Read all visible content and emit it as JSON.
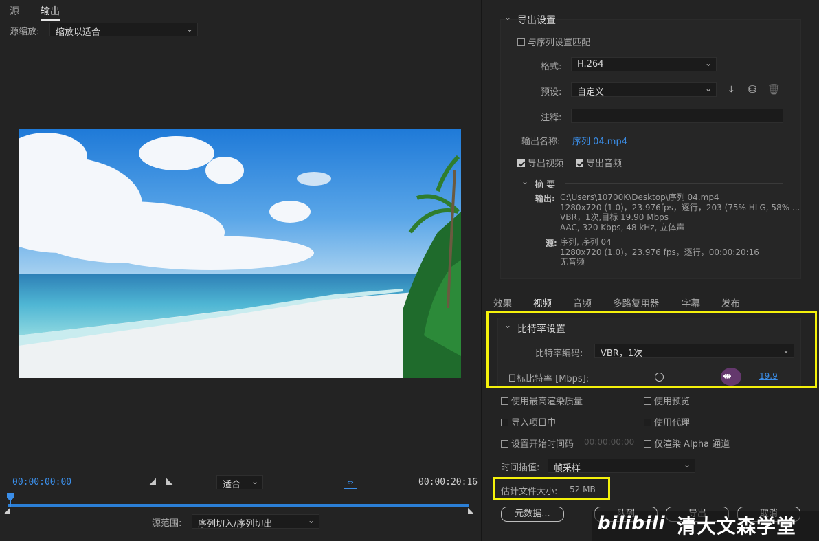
{
  "left": {
    "tabs": [
      "源",
      "输出"
    ],
    "source_zoom_label": "源缩放:",
    "source_zoom_value": "缩放以适合",
    "time_start": "00:00:00:00",
    "time_end": "00:00:20:16",
    "fit_value": "适合",
    "source_range_label": "源范围:",
    "source_range_value": "序列切入/序列切出"
  },
  "export": {
    "section_title": "导出设置",
    "match_sequence": "与序列设置匹配",
    "format_label": "格式:",
    "format_value": "H.264",
    "preset_label": "预设:",
    "preset_value": "自定义",
    "comment_label": "注释:",
    "comment_value": "",
    "output_name_label": "输出名称:",
    "output_name_value": "序列 04.mp4",
    "export_video": "导出视频",
    "export_audio": "导出音频",
    "summary_title": "摘 要",
    "summary_output_label": "输出:",
    "summary_output_lines": [
      "C:\\Users\\10700K\\Desktop\\序列 04.mp4",
      "1280x720 (1.0)，23.976fps，逐行，203 (75% HLG, 58% ...",
      "VBR，1次,目标 19.90 Mbps",
      "AAC, 320 Kbps, 48  kHz, 立体声"
    ],
    "summary_source_label": "源:",
    "summary_source_lines": [
      "序列, 序列 04",
      "1280x720 (1.0)，23.976 fps，逐行，00:00:20:16",
      "无音频"
    ]
  },
  "right_tabs": [
    "效果",
    "视频",
    "音频",
    "多路复用器",
    "字幕",
    "发布"
  ],
  "bitrate": {
    "section_title": "比特率设置",
    "encoding_label": "比特率编码:",
    "encoding_value": "VBR，1次",
    "target_label": "目标比特率 [Mbps]:",
    "target_value": "19.9",
    "slider_fraction": 0.5
  },
  "options": {
    "max_render_quality": "使用最高渲染质量",
    "use_previews": "使用预览",
    "import_into_project": "导入项目中",
    "use_proxies": "使用代理",
    "set_start_timecode": "设置开始时间码",
    "start_timecode_value": "00:00:00:00",
    "render_alpha_only": "仅渲染 Alpha 通道",
    "time_interpolation_label": "时间插值:",
    "time_interpolation_value": "帧采样",
    "estimated_size_label": "估计文件大小:",
    "estimated_size_value": "52 MB"
  },
  "buttons": {
    "metadata": "元数据...",
    "queue": "队列",
    "export": "导出",
    "cancel": "取消"
  },
  "watermark": {
    "logo": "bilibili",
    "text": "清大文森学堂"
  },
  "colors": {
    "accent": "#3b8ee8",
    "highlight": "#f4f10b"
  }
}
